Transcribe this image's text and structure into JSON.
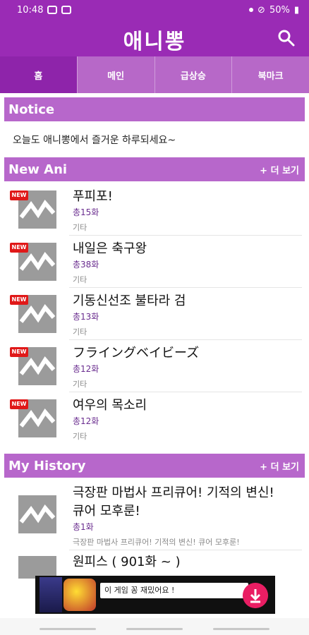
{
  "status": {
    "time": "10:48",
    "battery": "50%"
  },
  "app": {
    "title": "애니뽕"
  },
  "tabs": [
    {
      "label": "홈",
      "active": true
    },
    {
      "label": "메인",
      "active": false
    },
    {
      "label": "급상승",
      "active": false
    },
    {
      "label": "북마크",
      "active": false
    }
  ],
  "notice": {
    "heading": "Notice",
    "text": "오늘도 애니뽕에서 즐거운 하루되세요~"
  },
  "new_ani": {
    "heading": "New Ani",
    "more": "+ 더 보기",
    "badge": "NEW",
    "items": [
      {
        "title": "푸피포!",
        "episodes": "총15화",
        "genre": "기타"
      },
      {
        "title": "내일은 축구왕",
        "episodes": "총38화",
        "genre": "기타"
      },
      {
        "title": "기동신선조 불타라 검",
        "episodes": "총13화",
        "genre": "기타"
      },
      {
        "title": "フライングベイビーズ",
        "episodes": "총12화",
        "genre": "기타"
      },
      {
        "title": "여우의 목소리",
        "episodes": "총12화",
        "genre": "기타"
      }
    ]
  },
  "history": {
    "heading": "My History",
    "more": "+ 더 보기",
    "items": [
      {
        "title_line1": "극장판 마법사 프리큐어! 기적의 변신!",
        "title_line2": "큐어 모후룬!",
        "episodes": "총1화",
        "subtitle": "극장판 마법사 프리큐어! 기적의 변신! 큐어 모후룬!"
      },
      {
        "title_line1": "원피스 ( 901화 ~ )"
      }
    ]
  },
  "ad": {
    "text": "이 게임 꽁 재밌어요 !"
  },
  "colors": {
    "primary": "#9a2bb5",
    "section": "#b767cb",
    "tab_active": "#8e24aa",
    "badge": "#e01818"
  }
}
